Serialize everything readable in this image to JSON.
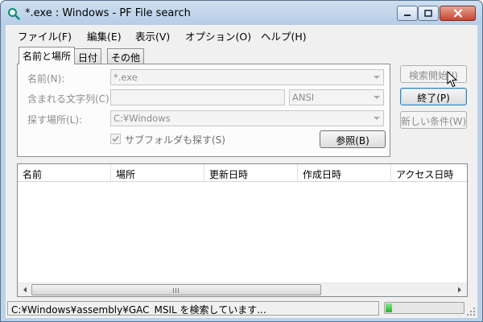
{
  "window": {
    "title": "*.exe : Windows - PF File search",
    "minimize_label": "Minimize",
    "maximize_label": "Maximize",
    "close_label": "Close"
  },
  "menu": {
    "items": [
      {
        "label": "ファイル(F)"
      },
      {
        "label": "編集(E)"
      },
      {
        "label": "表示(V)"
      },
      {
        "label": "オプション(O)"
      },
      {
        "label": "ヘルプ(H)"
      }
    ]
  },
  "tabs": [
    {
      "label": "名前と場所",
      "active": true
    },
    {
      "label": "日付",
      "active": false
    },
    {
      "label": "その他",
      "active": false
    }
  ],
  "form": {
    "name_label": "名前(N):",
    "name_value": "*.exe",
    "contains_label": "含まれる文字列(C):",
    "contains_value": "",
    "encoding_value": "ANSI",
    "location_label": "探す場所(L):",
    "location_value": "C:¥Windows",
    "subfolders_label": "サブフォルダも探す(S)",
    "subfolders_checked": true,
    "browse_label": "参照(B)"
  },
  "buttons": {
    "search_label": "検索開始(I)",
    "search_enabled": false,
    "exit_label": "終了(P)",
    "new_criteria_label": "新しい条件(W)",
    "new_criteria_enabled": false
  },
  "results": {
    "columns": [
      "名前",
      "場所",
      "更新日時",
      "作成日時",
      "アクセス日時"
    ],
    "rows": []
  },
  "status": {
    "text": "C:¥Windows¥assembly¥GAC_MSIL を検索しています...",
    "progress": 0.08
  },
  "colors": {
    "frame": "#bdd1e7",
    "progress_green": "#27b327",
    "disabled_text": "#8d8d8d"
  }
}
